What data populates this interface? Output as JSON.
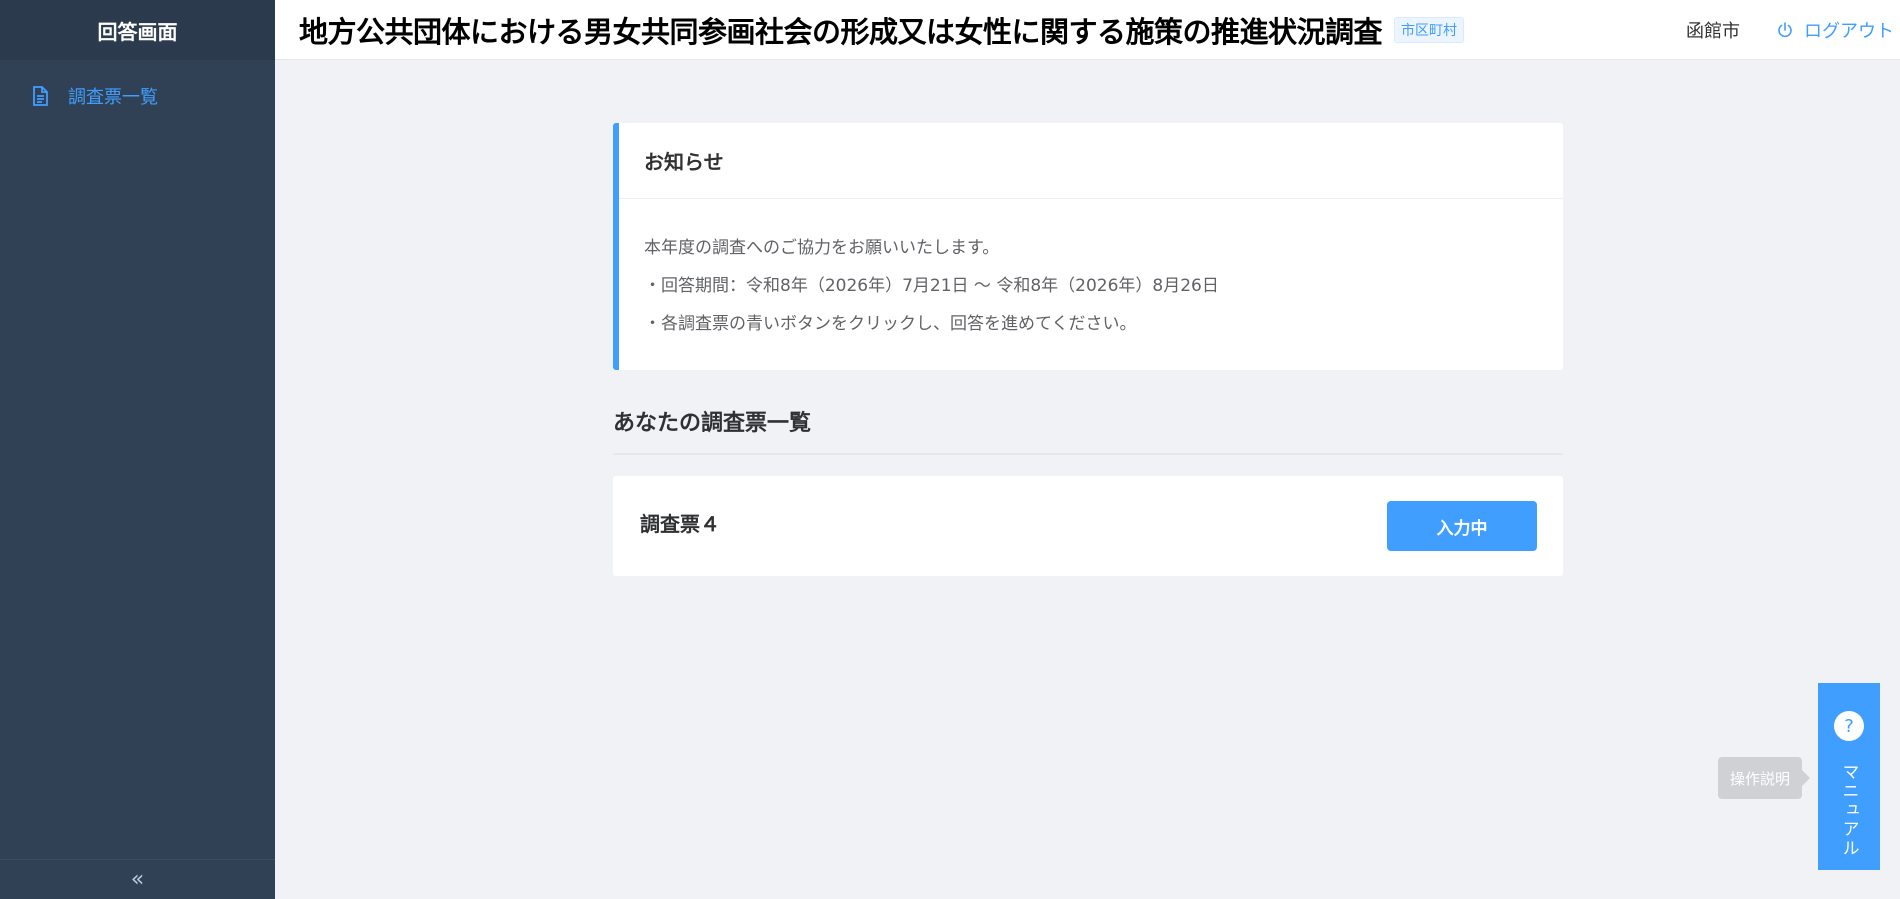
{
  "sidebar": {
    "title": "回答画面",
    "items": [
      {
        "label": "調査票一覧",
        "icon": "document-icon"
      }
    ],
    "collapse_glyph": "«"
  },
  "header": {
    "title": "地方公共団体における男女共同参画社会の形成又は女性に関する施策の推進状況調査",
    "tag": "市区町村",
    "user": "函館市",
    "logout_label": "ログアウト"
  },
  "notice": {
    "title": "お知らせ",
    "lines": [
      "本年度の調査へのご協力をお願いいたします。",
      "・回答期間：令和8年（2026年）7月21日 ～ 令和8年（2026年）8月26日",
      "・各調査票の青いボタンをクリックし、回答を進めてください。"
    ]
  },
  "survey_list": {
    "title": "あなたの調査票一覧",
    "items": [
      {
        "name": "調査票４",
        "button_label": "入力中"
      }
    ]
  },
  "manual": {
    "label": "マニュアル",
    "help_glyph": "?",
    "tooltip": "操作説明"
  },
  "colors": {
    "accent": "#409eff",
    "sidebar_bg": "#304156",
    "page_bg": "#f0f2f5"
  }
}
